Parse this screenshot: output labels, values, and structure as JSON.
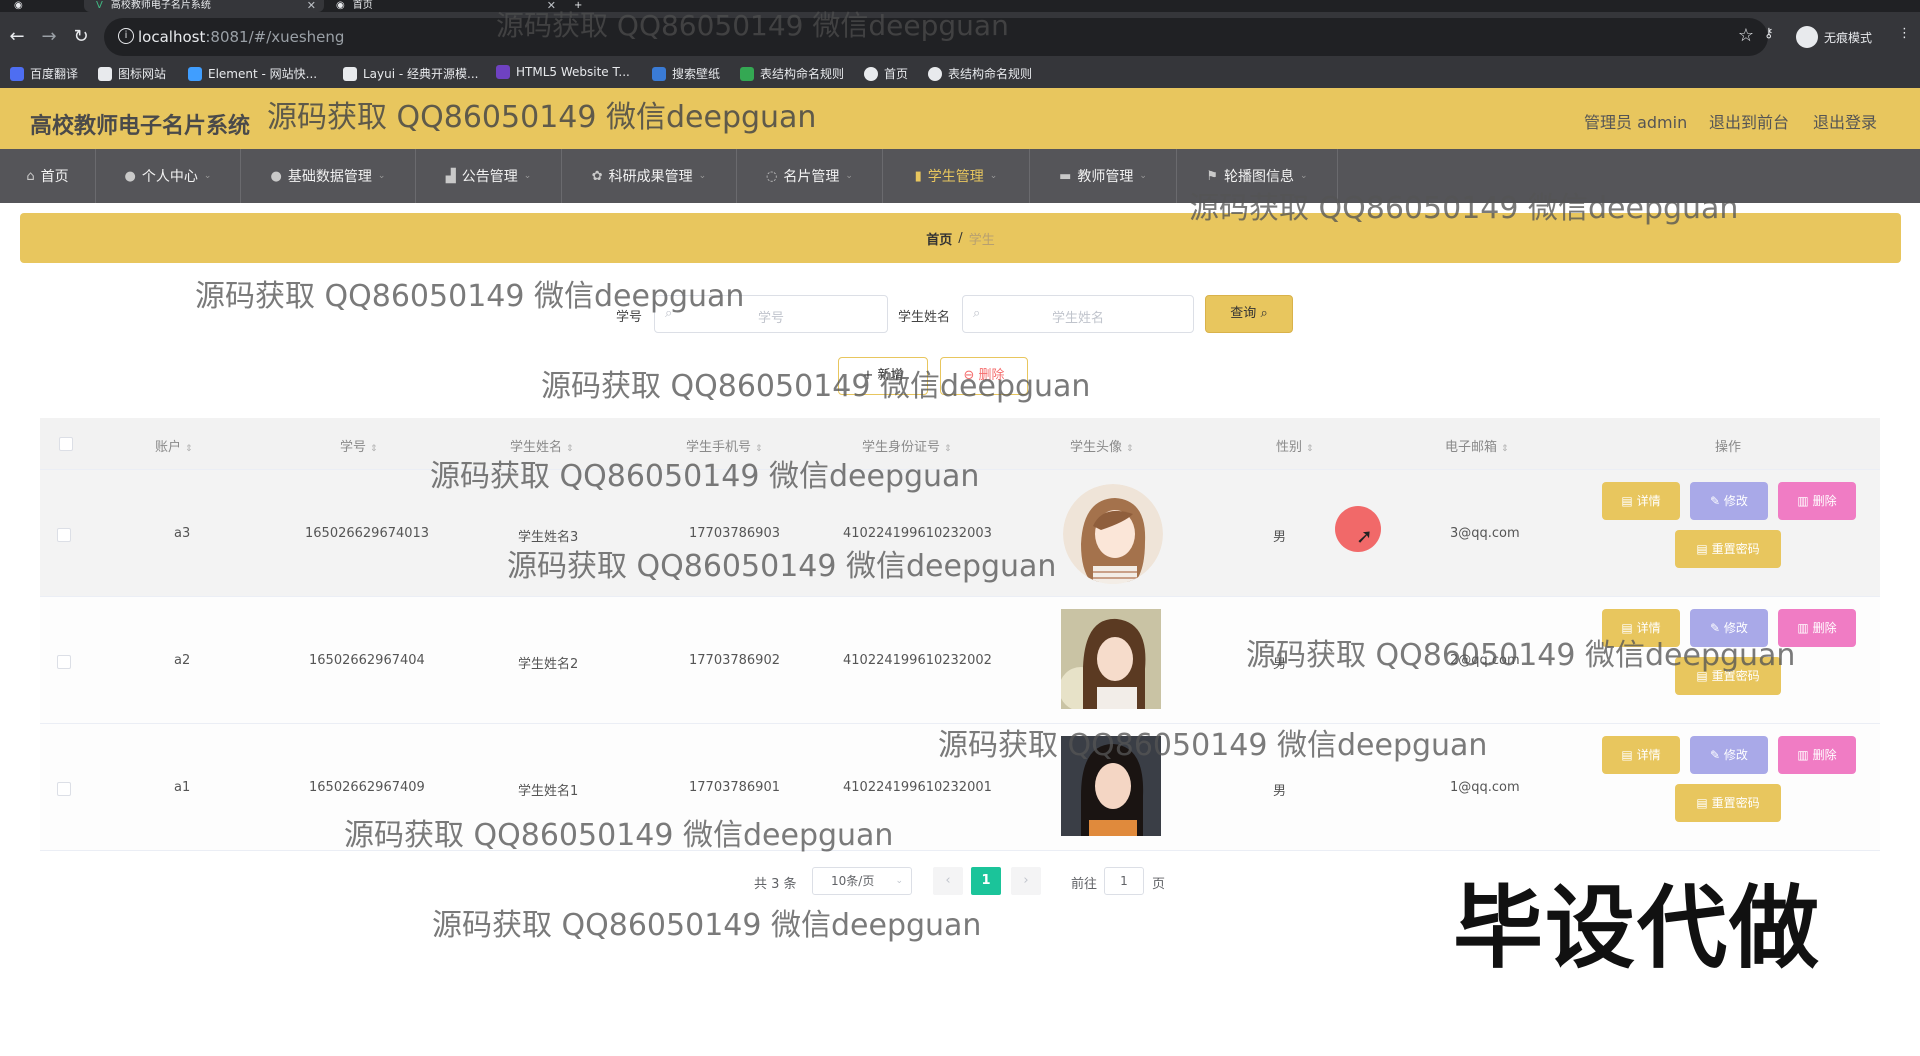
{
  "browser": {
    "tabs": [
      {
        "title": "高校教师电子名片系统",
        "active": true
      },
      {
        "title": "首页",
        "active": false
      }
    ],
    "url_host": "localhost",
    "url_rest": ":8081/#/xuesheng",
    "profile_label": "无痕模式",
    "bookmarks": [
      {
        "label": "百度翻译",
        "icon_color": "#4e6ef2"
      },
      {
        "label": "图标网站",
        "icon_color": "#e8eaed"
      },
      {
        "label": "Element - 网站快...",
        "icon_color": "#409eff"
      },
      {
        "label": "Layui - 经典开源模...",
        "icon_color": "#e8eaed"
      },
      {
        "label": "HTML5 Website T...",
        "icon_color": "#6f42c1"
      },
      {
        "label": "搜索壁纸",
        "icon_color": "#3a7bd5"
      },
      {
        "label": "表结构命名规则",
        "icon_color": "#34a853"
      },
      {
        "label": "首页",
        "icon_color": "#e8eaed"
      },
      {
        "label": "表结构命名规则",
        "icon_color": "#e8eaed"
      }
    ]
  },
  "header": {
    "title": "高校教师电子名片系统",
    "admin_label": "管理员 admin",
    "front_link": "退出到前台",
    "logout_link": "退出登录"
  },
  "nav": [
    {
      "label": "首页",
      "icon": "home-icon",
      "glyph": "⌂"
    },
    {
      "label": "个人中心",
      "icon": "user-icon",
      "glyph": "●"
    },
    {
      "label": "基础数据管理",
      "icon": "user-icon",
      "glyph": "●"
    },
    {
      "label": "公告管理",
      "icon": "chart-icon",
      "glyph": "▟"
    },
    {
      "label": "科研成果管理",
      "icon": "gear-icon",
      "glyph": "✿"
    },
    {
      "label": "名片管理",
      "icon": "refresh-icon",
      "glyph": "◌"
    },
    {
      "label": "学生管理",
      "icon": "bar-chart-icon",
      "glyph": "▮"
    },
    {
      "label": "教师管理",
      "icon": "monitor-icon",
      "glyph": "▬"
    },
    {
      "label": "轮播图信息",
      "icon": "flag-icon",
      "glyph": "⚑"
    }
  ],
  "breadcrumb": {
    "home": "首页",
    "sep": "/",
    "current": "学生"
  },
  "search": {
    "student_no_label": "学号",
    "student_no_placeholder": "学号",
    "student_name_label": "学生姓名",
    "student_name_placeholder": "学生姓名",
    "query_button": "查询",
    "add_button": "新增",
    "delete_button": "删除"
  },
  "table": {
    "columns": [
      "账户",
      "学号",
      "学生姓名",
      "学生手机号",
      "学生身份证号",
      "学生头像",
      "性别",
      "电子邮箱",
      "操作"
    ],
    "rows": [
      {
        "account": "a3",
        "student_no": "165026629674013",
        "name": "学生姓名3",
        "phone": "17703786903",
        "id_card": "410224199610232003",
        "gender": "男",
        "email": "3@qq.com"
      },
      {
        "account": "a2",
        "student_no": "16502662967404",
        "name": "学生姓名2",
        "phone": "17703786902",
        "id_card": "410224199610232002",
        "gender": "男",
        "email": "2@qq.com"
      },
      {
        "account": "a1",
        "student_no": "16502662967409",
        "name": "学生姓名1",
        "phone": "17703786901",
        "id_card": "410224199610232001",
        "gender": "男",
        "email": "1@qq.com"
      }
    ],
    "ops": {
      "detail": "详情",
      "edit": "修改",
      "delete": "删除",
      "reset": "重置密码"
    }
  },
  "pagination": {
    "total_label": "共 3 条",
    "page_size": "10条/页",
    "current_page": "1",
    "goto_label": "前往",
    "goto_value": "1",
    "page_unit": "页"
  },
  "overlay": {
    "watermark": "源码获取 QQ86050149 微信deepguan",
    "big_text": "毕设代做"
  },
  "colors": {
    "accent": "#e8c65e",
    "nav_bg": "#555559",
    "page_active": "#1bc49a",
    "delete_pink": "#f07cc4",
    "edit_purple": "#a9a9e8"
  }
}
